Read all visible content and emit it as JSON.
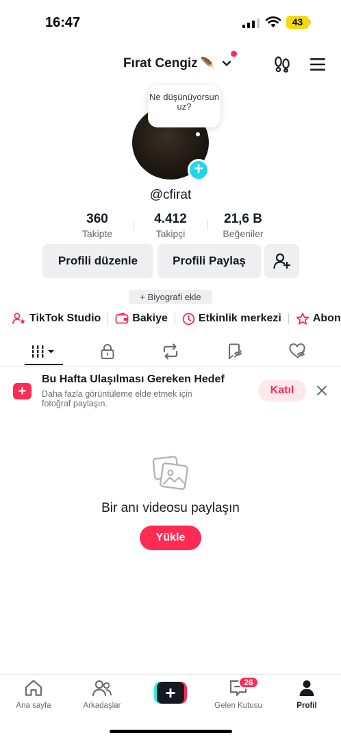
{
  "status_bar": {
    "time": "16:47",
    "battery": "43"
  },
  "header": {
    "name": "Fırat Cengiz",
    "emoji": "🪶"
  },
  "profile": {
    "bubble_text": "Ne düşünüyorsun uz?",
    "username": "@cfirat",
    "stats": [
      {
        "value": "360",
        "label": "Takipte"
      },
      {
        "value": "4.412",
        "label": "Takipçi"
      },
      {
        "value": "21,6 B",
        "label": "Beğeniler"
      }
    ],
    "edit_button": "Profili düzenle",
    "share_button": "Profili Paylaş",
    "bio_chip": "+ Biyografi ekle"
  },
  "quick_links": [
    {
      "label": "TikTok Studio",
      "icon": "person-star-icon"
    },
    {
      "label": "Bakiye",
      "icon": "wallet-icon"
    },
    {
      "label": "Etkinlik merkezi",
      "icon": "clock-icon"
    },
    {
      "label": "Abonel",
      "icon": "star-badge-icon"
    }
  ],
  "goal": {
    "title": "Bu Hafta Ulaşılması Gereken Hedef",
    "description": "Daha fazla görüntüleme elde etmek için fotoğraf paylaşın.",
    "join_label": "Katıl"
  },
  "empty_state": {
    "title": "Bir anı videosu paylaşın",
    "upload_label": "Yükle"
  },
  "bottom_nav": {
    "home": "Ana sayfa",
    "friends": "Arkadaşlar",
    "inbox": "Gelen Kutusu",
    "inbox_badge": "26",
    "profile": "Profil"
  },
  "colors": {
    "accent": "#fe2c55",
    "cyan": "#20d5ec",
    "text": "#161823"
  }
}
